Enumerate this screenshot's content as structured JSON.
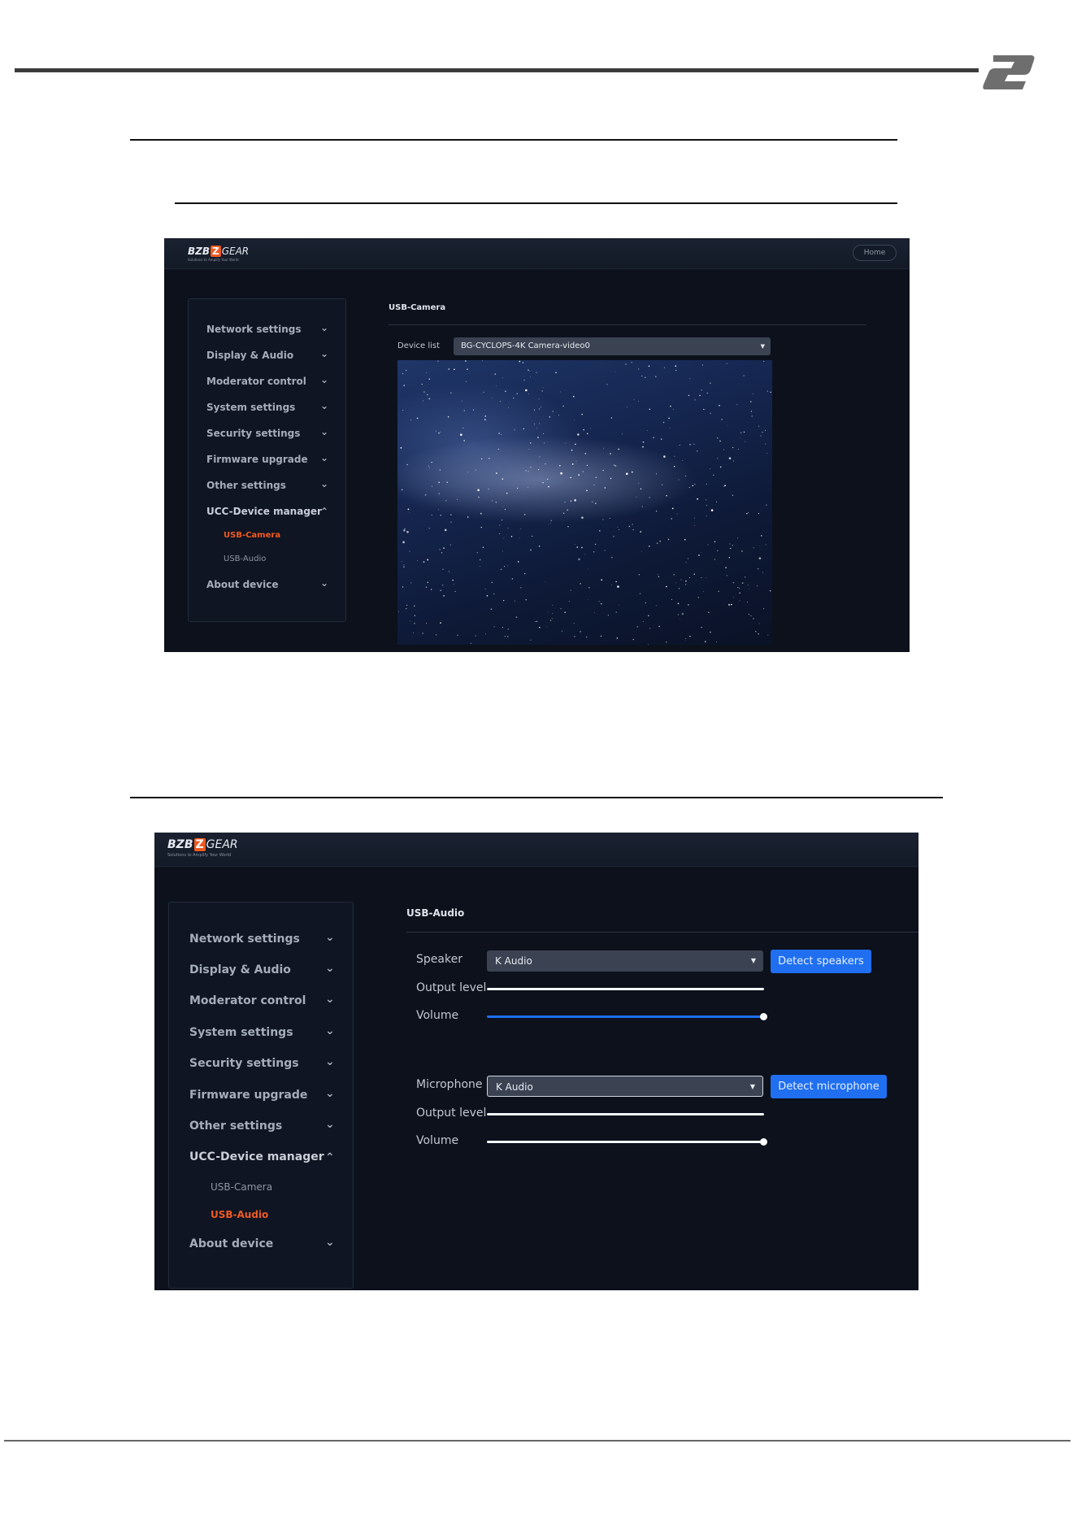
{
  "brand": {
    "name_left": "BZB",
    "name_mark": "Z",
    "name_right": "GEAR",
    "tagline": "Solutions to Amplify Your World"
  },
  "camera_screen": {
    "home_label": "Home",
    "nav": [
      {
        "label": "Network settings",
        "chevron": "chevron-down-icon"
      },
      {
        "label": "Display & Audio",
        "chevron": "chevron-down-icon"
      },
      {
        "label": "Moderator control",
        "chevron": "chevron-down-icon"
      },
      {
        "label": "System settings",
        "chevron": "chevron-down-icon"
      },
      {
        "label": "Security settings",
        "chevron": "chevron-down-icon"
      },
      {
        "label": "Firmware upgrade",
        "chevron": "chevron-down-icon"
      },
      {
        "label": "Other settings",
        "chevron": "chevron-down-icon"
      },
      {
        "label": "UCC-Device manager",
        "chevron": "chevron-up-icon"
      },
      {
        "label": "About device",
        "chevron": "chevron-down-icon"
      }
    ],
    "sub_items": [
      {
        "label": "USB-Camera",
        "active": true
      },
      {
        "label": "USB-Audio",
        "active": false
      }
    ],
    "section_title": "USB-Camera",
    "device_list_label": "Device list",
    "device_list_value": "BG-CYCLOPS-4K Camera-video0"
  },
  "audio_screen": {
    "nav": [
      {
        "label": "Network settings",
        "chevron": "chevron-down-icon"
      },
      {
        "label": "Display & Audio",
        "chevron": "chevron-down-icon"
      },
      {
        "label": "Moderator control",
        "chevron": "chevron-down-icon"
      },
      {
        "label": "System settings",
        "chevron": "chevron-down-icon"
      },
      {
        "label": "Security settings",
        "chevron": "chevron-down-icon"
      },
      {
        "label": "Firmware upgrade",
        "chevron": "chevron-down-icon"
      },
      {
        "label": "Other settings",
        "chevron": "chevron-down-icon"
      },
      {
        "label": "UCC-Device manager",
        "chevron": "chevron-up-icon"
      },
      {
        "label": "About device",
        "chevron": "chevron-down-icon"
      }
    ],
    "sub_items": [
      {
        "label": "USB-Camera",
        "active": false
      },
      {
        "label": "USB-Audio",
        "active": true
      }
    ],
    "section_title": "USB-Audio",
    "speaker": {
      "label": "Speaker",
      "value": "K Audio",
      "detect_label": "Detect speakers",
      "output_level_label": "Output level",
      "volume_label": "Volume",
      "volume_fraction": 1.0
    },
    "microphone": {
      "label": "Microphone",
      "value": "K Audio",
      "detect_label": "Detect microphone",
      "output_level_label": "Output level",
      "volume_label": "Volume",
      "volume_fraction": 1.0
    }
  },
  "colors": {
    "accent_orange": "#f05a22",
    "button_blue": "#1f6ff0",
    "speaker_volume_fill": "#1f6ff0",
    "microphone_volume_fill": "#f2f4f7"
  }
}
